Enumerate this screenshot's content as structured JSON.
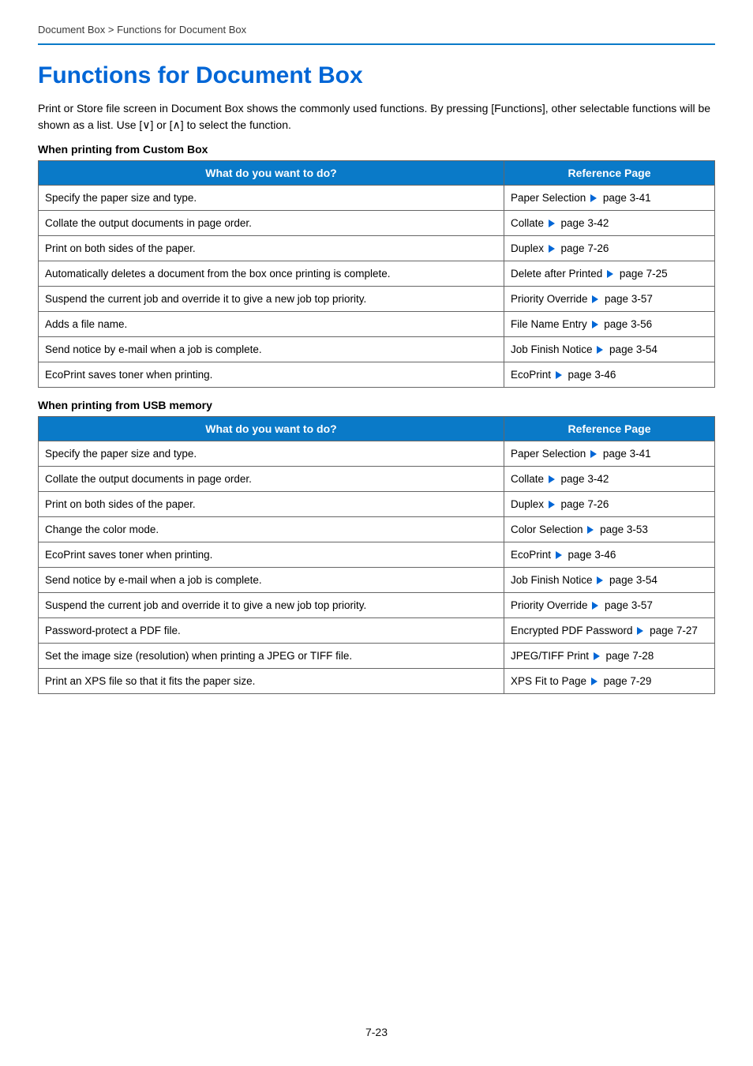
{
  "breadcrumb": {
    "section": "Document Box",
    "sep": ">",
    "page": "Functions for Document Box"
  },
  "title": "Functions for Document Box",
  "intro_a": "Print or Store file screen in Document Box shows the commonly used functions. By pressing [Functions], other selectable functions will be shown as a list. Use [",
  "intro_b": "] or [",
  "intro_c": "] to select the function.",
  "chev_down": "∨",
  "chev_up": "∧",
  "headers": {
    "col1": "What do you want to do?",
    "col2": "Reference Page"
  },
  "section1": {
    "heading": "When printing from Custom Box",
    "rows": [
      {
        "task": "Specify the paper size and type.",
        "ref_name": "Paper Selection",
        "ref_page": "page 3-41"
      },
      {
        "task": "Collate the output documents in page order.",
        "ref_name": "Collate",
        "ref_page": "page 3-42"
      },
      {
        "task": "Print on both sides of the paper.",
        "ref_name": "Duplex",
        "ref_page": "page 7-26"
      },
      {
        "task": "Automatically deletes a document from the box once printing is complete.",
        "ref_name": "Delete after Printed",
        "ref_page": "page 7-25"
      },
      {
        "task": "Suspend the current job and override it to give a new job top priority.",
        "ref_name": "Priority Override",
        "ref_page": "page 3-57"
      },
      {
        "task": "Adds a file name.",
        "ref_name": "File Name Entry",
        "ref_page": "page 3-56"
      },
      {
        "task": "Send notice by e-mail when a job is complete.",
        "ref_name": "Job Finish Notice",
        "ref_page": "page 3-54"
      },
      {
        "task": "EcoPrint saves toner when printing.",
        "ref_name": "EcoPrint",
        "ref_page": "page 3-46"
      }
    ]
  },
  "section2": {
    "heading": "When printing from USB memory",
    "rows": [
      {
        "task": "Specify the paper size and type.",
        "ref_name": "Paper Selection",
        "ref_page": "page 3-41"
      },
      {
        "task": "Collate the output documents in page order.",
        "ref_name": "Collate",
        "ref_page": "page 3-42"
      },
      {
        "task": "Print on both sides of the paper.",
        "ref_name": "Duplex",
        "ref_page": "page 7-26"
      },
      {
        "task": "Change the color mode.",
        "ref_name": "Color Selection",
        "ref_page": "page 3-53"
      },
      {
        "task": "EcoPrint saves toner when printing.",
        "ref_name": "EcoPrint",
        "ref_page": "page 3-46"
      },
      {
        "task": "Send notice by e-mail when a job is complete.",
        "ref_name": "Job Finish Notice",
        "ref_page": "page 3-54"
      },
      {
        "task": "Suspend the current job and override it to give a new job top priority.",
        "ref_name": "Priority Override",
        "ref_page": "page 3-57"
      },
      {
        "task": "Password-protect a PDF file.",
        "ref_name": "Encrypted PDF Password",
        "ref_page": "page 7-27"
      },
      {
        "task": "Set the image size (resolution) when printing a JPEG or TIFF file.",
        "ref_name": "JPEG/TIFF Print",
        "ref_page": "page 7-28"
      },
      {
        "task": "Print an XPS file so that it fits the paper size.",
        "ref_name": "XPS Fit to Page",
        "ref_page": "page 7-29"
      }
    ]
  },
  "page_number": "7-23"
}
